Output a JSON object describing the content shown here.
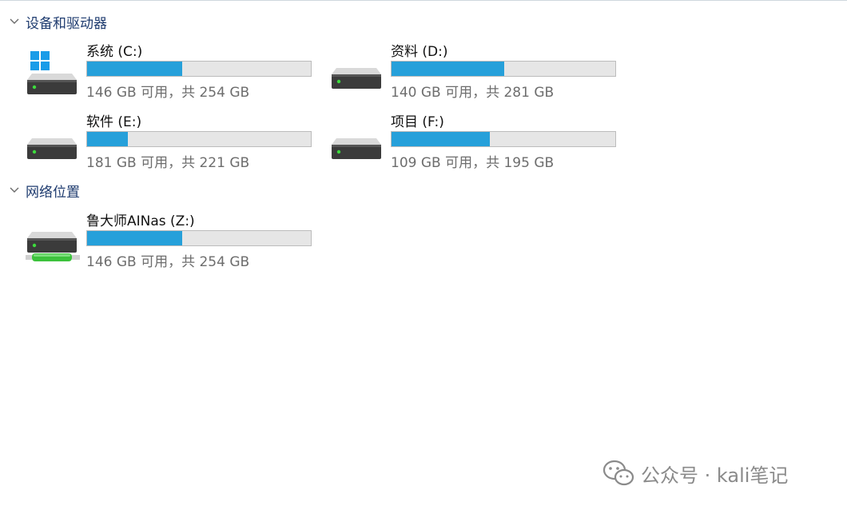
{
  "sections": [
    {
      "title": "设备和驱动器"
    },
    {
      "title": "网络位置"
    }
  ],
  "drives": [
    {
      "name": "系统 (C:)",
      "info": "146 GB 可用，共 254 GB",
      "used_fraction": 0.425,
      "icon": "windows-drive-icon"
    },
    {
      "name": "资料 (D:)",
      "info": "140 GB 可用，共 281 GB",
      "used_fraction": 0.502,
      "icon": "hard-drive-icon"
    },
    {
      "name": "软件 (E:)",
      "info": "181 GB 可用，共 221 GB",
      "used_fraction": 0.181,
      "icon": "hard-drive-icon"
    },
    {
      "name": "项目 (F:)",
      "info": "109 GB 可用，共 195 GB",
      "used_fraction": 0.441,
      "icon": "hard-drive-icon"
    },
    {
      "name": "鲁大师AINas (Z:)",
      "info": "146 GB 可用，共 254 GB",
      "used_fraction": 0.425,
      "icon": "network-drive-icon"
    }
  ],
  "watermark": {
    "text": "公众号 · kali笔记",
    "icon": "wechat-icon"
  },
  "colors": {
    "bar_fill": "#26a0da",
    "bar_track": "#e6e6e6",
    "section_title": "#1e3b6f",
    "network_green": "#3cc23c"
  }
}
